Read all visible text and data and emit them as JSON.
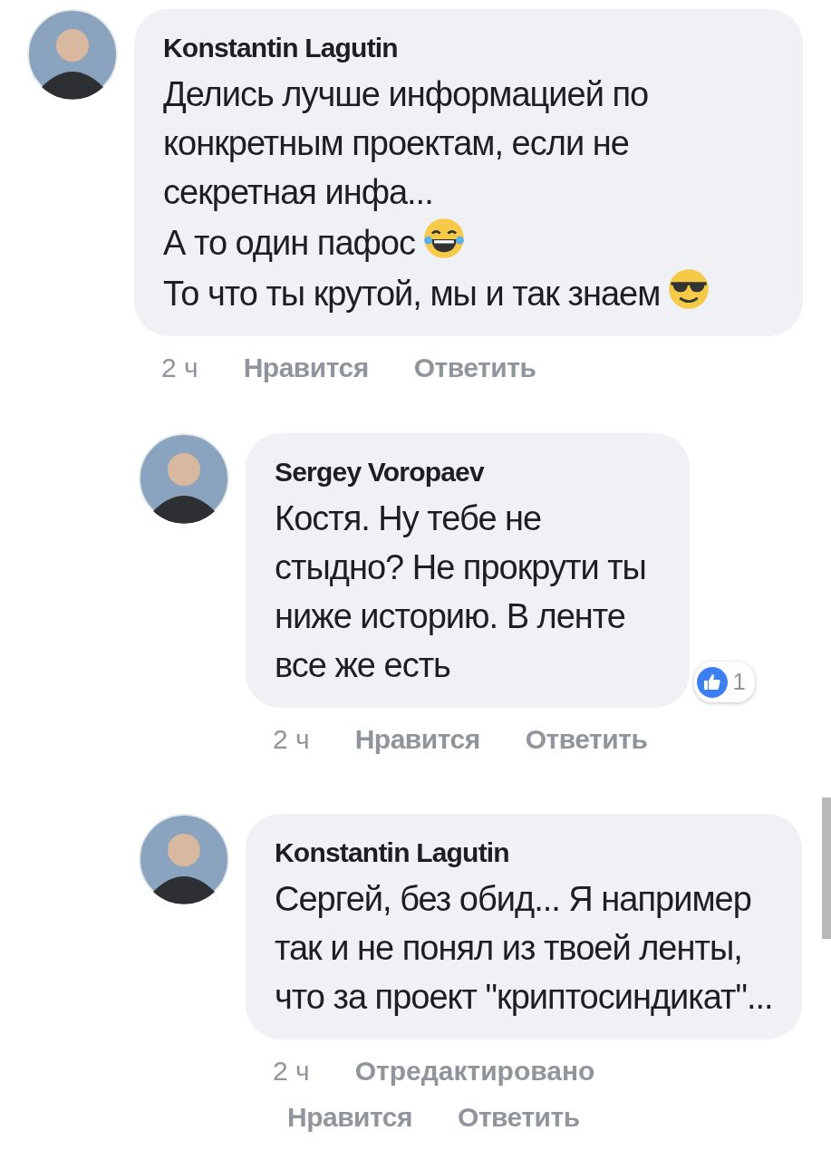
{
  "comments": [
    {
      "author": "Konstantin Lagutin",
      "paragraphs": [
        {
          "text": "Делись лучше информацией по конкретным проектам, если не секретная инфа..."
        },
        {
          "text": "А то один пафос",
          "emoji": {
            "kind": "tears-of-joy"
          }
        },
        {
          "text": "То что ты крутой, мы и так знаем",
          "emoji": {
            "kind": "sunglasses"
          }
        }
      ],
      "time": "2 ч",
      "actions": [
        "Нравится",
        "Ответить"
      ],
      "replies": [
        {
          "author": "Sergey Voropaev",
          "paragraphs": [
            {
              "text": "Костя. Ну тебе не стыдно? Не прокрути ты ниже историю. В ленте все же есть"
            }
          ],
          "reaction": {
            "count": "1"
          },
          "time": "2 ч",
          "actions": [
            "Нравится",
            "Ответить"
          ]
        },
        {
          "author": "Konstantin Lagutin",
          "paragraphs": [
            {
              "text": "Сергей, без обид... Я например так и не понял из твоей ленты, что за проект \"криптосиндикат\"..."
            }
          ],
          "time": "2 ч",
          "edited": "Отредактировано",
          "actions": [
            "Нравится",
            "Ответить"
          ]
        }
      ]
    }
  ]
}
